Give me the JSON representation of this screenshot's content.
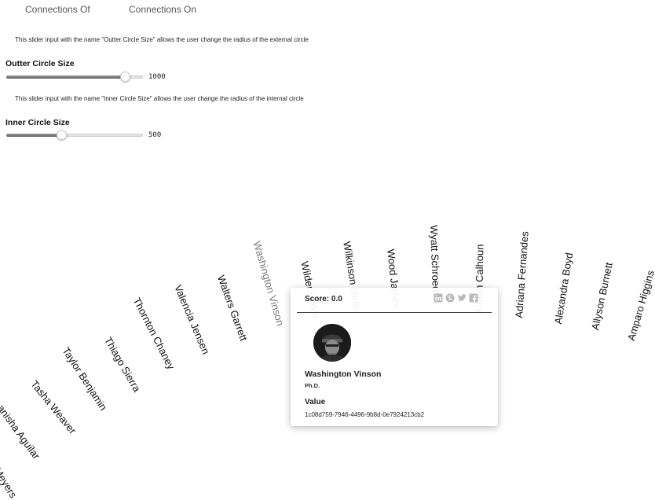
{
  "tabs": [
    {
      "label": "Connections Of"
    },
    {
      "label": "Connections On"
    }
  ],
  "outer": {
    "description": "This slider input with the name \"Outter Circle Size\" allows the user change the radius of the external circle",
    "label": "Outter Circle Size",
    "value": "1000",
    "level": 0.9
  },
  "inner": {
    "description": "This slider input with the name \"Inner Circle Size\" allows the user change the radius of the internal circle",
    "label": "Inner Circle Size",
    "value": "500",
    "level": 0.4
  },
  "names": [
    "Meyers",
    "anisha Aguilar",
    "Tasha Weaver",
    "Taylor Benjamin",
    "Thiago Sierra",
    "Thornton Chaney",
    "Valencia Jensen",
    "Walters Garrett",
    "Washington Vinson",
    "Wilder Lewis",
    "Wilkinson Dean",
    "Wood James",
    "Wyatt Schroeder",
    "Adrian Calhoun",
    "Adriana Fernandes",
    "Alexandra Boyd",
    "Allyson Burnett",
    "Amparo Higgins"
  ],
  "highlighted_name": "Washington Vinson",
  "tooltip": {
    "score": "Score: 0.0",
    "name": "Washington Vinson",
    "degree": "Ph.D.",
    "value_label": "Value",
    "value": "1c08d759-7946-4496-9b8d-0e7924213cb2",
    "icons": [
      "linkedin-icon",
      "skype-icon",
      "twitter-icon",
      "facebook-icon"
    ]
  }
}
